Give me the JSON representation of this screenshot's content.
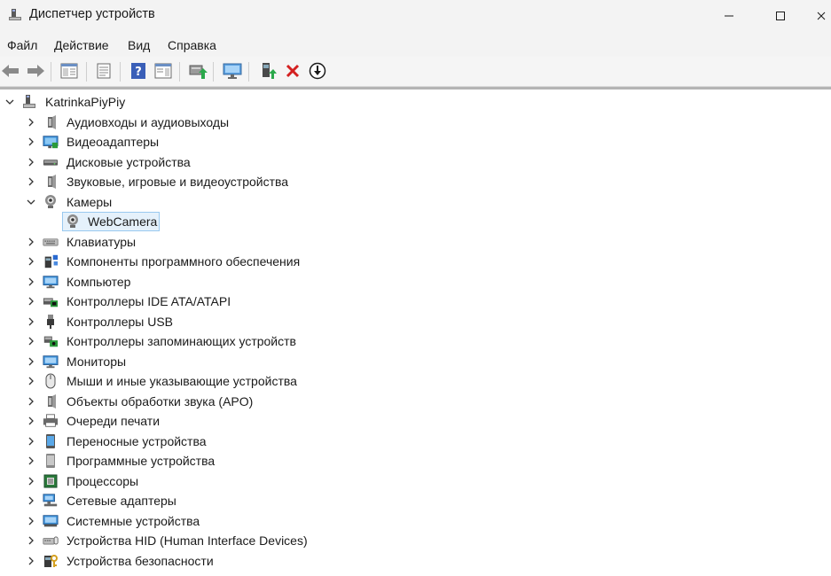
{
  "window": {
    "title": "Диспетчер устройств"
  },
  "menu": {
    "file": "Файл",
    "action": "Действие",
    "view": "Вид",
    "help": "Справка"
  },
  "tree": {
    "root": "KatrinkaPiyPiy",
    "categories": [
      {
        "label": "Аудиовходы и аудиовыходы",
        "icon": "speaker-icon"
      },
      {
        "label": "Видеоадаптеры",
        "icon": "display-adapter-icon"
      },
      {
        "label": "Дисковые устройства",
        "icon": "disk-drive-icon"
      },
      {
        "label": "Звуковые, игровые и видеоустройства",
        "icon": "speaker-icon"
      },
      {
        "label": "Камеры",
        "icon": "camera-icon",
        "expanded": true,
        "children": [
          "WebCamera"
        ]
      },
      {
        "label": "Клавиатуры",
        "icon": "keyboard-icon"
      },
      {
        "label": "Компоненты программного обеспечения",
        "icon": "software-component-icon"
      },
      {
        "label": "Компьютер",
        "icon": "computer-icon"
      },
      {
        "label": "Контроллеры IDE ATA/ATAPI",
        "icon": "ide-controller-icon"
      },
      {
        "label": "Контроллеры USB",
        "icon": "usb-icon"
      },
      {
        "label": "Контроллеры запоминающих устройств",
        "icon": "storage-controller-icon"
      },
      {
        "label": "Мониторы",
        "icon": "monitor-icon"
      },
      {
        "label": "Мыши и иные указывающие устройства",
        "icon": "mouse-icon"
      },
      {
        "label": "Объекты обработки звука (APO)",
        "icon": "speaker-icon"
      },
      {
        "label": "Очереди печати",
        "icon": "printer-icon"
      },
      {
        "label": "Переносные устройства",
        "icon": "portable-device-icon"
      },
      {
        "label": "Программные устройства",
        "icon": "software-device-icon"
      },
      {
        "label": "Процессоры",
        "icon": "processor-icon"
      },
      {
        "label": "Сетевые адаптеры",
        "icon": "network-adapter-icon"
      },
      {
        "label": "Системные устройства",
        "icon": "system-device-icon"
      },
      {
        "label": "Устройства HID (Human Interface Devices)",
        "icon": "hid-icon"
      },
      {
        "label": "Устройства безопасности",
        "icon": "security-device-icon"
      }
    ]
  },
  "colors": {
    "selection_bg": "#e5f1fb",
    "selection_border": "#99c9ef",
    "remove_red": "#d42020"
  }
}
